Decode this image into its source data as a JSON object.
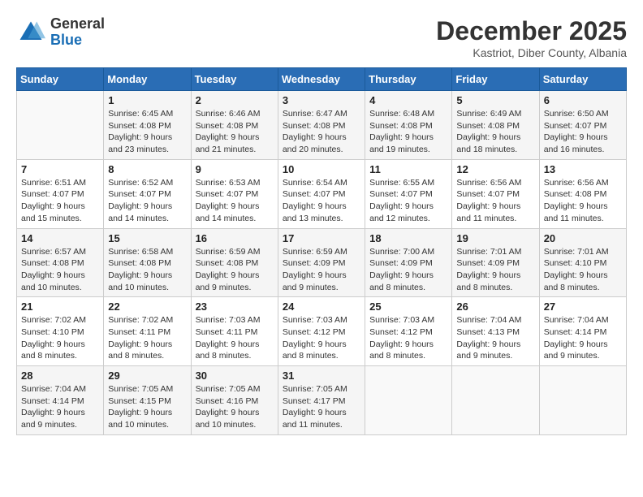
{
  "header": {
    "logo_general": "General",
    "logo_blue": "Blue",
    "month": "December 2025",
    "location": "Kastriot, Diber County, Albania"
  },
  "days_of_week": [
    "Sunday",
    "Monday",
    "Tuesday",
    "Wednesday",
    "Thursday",
    "Friday",
    "Saturday"
  ],
  "weeks": [
    [
      {
        "day": "",
        "info": ""
      },
      {
        "day": "1",
        "info": "Sunrise: 6:45 AM\nSunset: 4:08 PM\nDaylight: 9 hours\nand 23 minutes."
      },
      {
        "day": "2",
        "info": "Sunrise: 6:46 AM\nSunset: 4:08 PM\nDaylight: 9 hours\nand 21 minutes."
      },
      {
        "day": "3",
        "info": "Sunrise: 6:47 AM\nSunset: 4:08 PM\nDaylight: 9 hours\nand 20 minutes."
      },
      {
        "day": "4",
        "info": "Sunrise: 6:48 AM\nSunset: 4:08 PM\nDaylight: 9 hours\nand 19 minutes."
      },
      {
        "day": "5",
        "info": "Sunrise: 6:49 AM\nSunset: 4:08 PM\nDaylight: 9 hours\nand 18 minutes."
      },
      {
        "day": "6",
        "info": "Sunrise: 6:50 AM\nSunset: 4:07 PM\nDaylight: 9 hours\nand 16 minutes."
      }
    ],
    [
      {
        "day": "7",
        "info": "Sunrise: 6:51 AM\nSunset: 4:07 PM\nDaylight: 9 hours\nand 15 minutes."
      },
      {
        "day": "8",
        "info": "Sunrise: 6:52 AM\nSunset: 4:07 PM\nDaylight: 9 hours\nand 14 minutes."
      },
      {
        "day": "9",
        "info": "Sunrise: 6:53 AM\nSunset: 4:07 PM\nDaylight: 9 hours\nand 14 minutes."
      },
      {
        "day": "10",
        "info": "Sunrise: 6:54 AM\nSunset: 4:07 PM\nDaylight: 9 hours\nand 13 minutes."
      },
      {
        "day": "11",
        "info": "Sunrise: 6:55 AM\nSunset: 4:07 PM\nDaylight: 9 hours\nand 12 minutes."
      },
      {
        "day": "12",
        "info": "Sunrise: 6:56 AM\nSunset: 4:07 PM\nDaylight: 9 hours\nand 11 minutes."
      },
      {
        "day": "13",
        "info": "Sunrise: 6:56 AM\nSunset: 4:08 PM\nDaylight: 9 hours\nand 11 minutes."
      }
    ],
    [
      {
        "day": "14",
        "info": "Sunrise: 6:57 AM\nSunset: 4:08 PM\nDaylight: 9 hours\nand 10 minutes."
      },
      {
        "day": "15",
        "info": "Sunrise: 6:58 AM\nSunset: 4:08 PM\nDaylight: 9 hours\nand 10 minutes."
      },
      {
        "day": "16",
        "info": "Sunrise: 6:59 AM\nSunset: 4:08 PM\nDaylight: 9 hours\nand 9 minutes."
      },
      {
        "day": "17",
        "info": "Sunrise: 6:59 AM\nSunset: 4:09 PM\nDaylight: 9 hours\nand 9 minutes."
      },
      {
        "day": "18",
        "info": "Sunrise: 7:00 AM\nSunset: 4:09 PM\nDaylight: 9 hours\nand 8 minutes."
      },
      {
        "day": "19",
        "info": "Sunrise: 7:01 AM\nSunset: 4:09 PM\nDaylight: 9 hours\nand 8 minutes."
      },
      {
        "day": "20",
        "info": "Sunrise: 7:01 AM\nSunset: 4:10 PM\nDaylight: 9 hours\nand 8 minutes."
      }
    ],
    [
      {
        "day": "21",
        "info": "Sunrise: 7:02 AM\nSunset: 4:10 PM\nDaylight: 9 hours\nand 8 minutes."
      },
      {
        "day": "22",
        "info": "Sunrise: 7:02 AM\nSunset: 4:11 PM\nDaylight: 9 hours\nand 8 minutes."
      },
      {
        "day": "23",
        "info": "Sunrise: 7:03 AM\nSunset: 4:11 PM\nDaylight: 9 hours\nand 8 minutes."
      },
      {
        "day": "24",
        "info": "Sunrise: 7:03 AM\nSunset: 4:12 PM\nDaylight: 9 hours\nand 8 minutes."
      },
      {
        "day": "25",
        "info": "Sunrise: 7:03 AM\nSunset: 4:12 PM\nDaylight: 9 hours\nand 8 minutes."
      },
      {
        "day": "26",
        "info": "Sunrise: 7:04 AM\nSunset: 4:13 PM\nDaylight: 9 hours\nand 9 minutes."
      },
      {
        "day": "27",
        "info": "Sunrise: 7:04 AM\nSunset: 4:14 PM\nDaylight: 9 hours\nand 9 minutes."
      }
    ],
    [
      {
        "day": "28",
        "info": "Sunrise: 7:04 AM\nSunset: 4:14 PM\nDaylight: 9 hours\nand 9 minutes."
      },
      {
        "day": "29",
        "info": "Sunrise: 7:05 AM\nSunset: 4:15 PM\nDaylight: 9 hours\nand 10 minutes."
      },
      {
        "day": "30",
        "info": "Sunrise: 7:05 AM\nSunset: 4:16 PM\nDaylight: 9 hours\nand 10 minutes."
      },
      {
        "day": "31",
        "info": "Sunrise: 7:05 AM\nSunset: 4:17 PM\nDaylight: 9 hours\nand 11 minutes."
      },
      {
        "day": "",
        "info": ""
      },
      {
        "day": "",
        "info": ""
      },
      {
        "day": "",
        "info": ""
      }
    ]
  ]
}
